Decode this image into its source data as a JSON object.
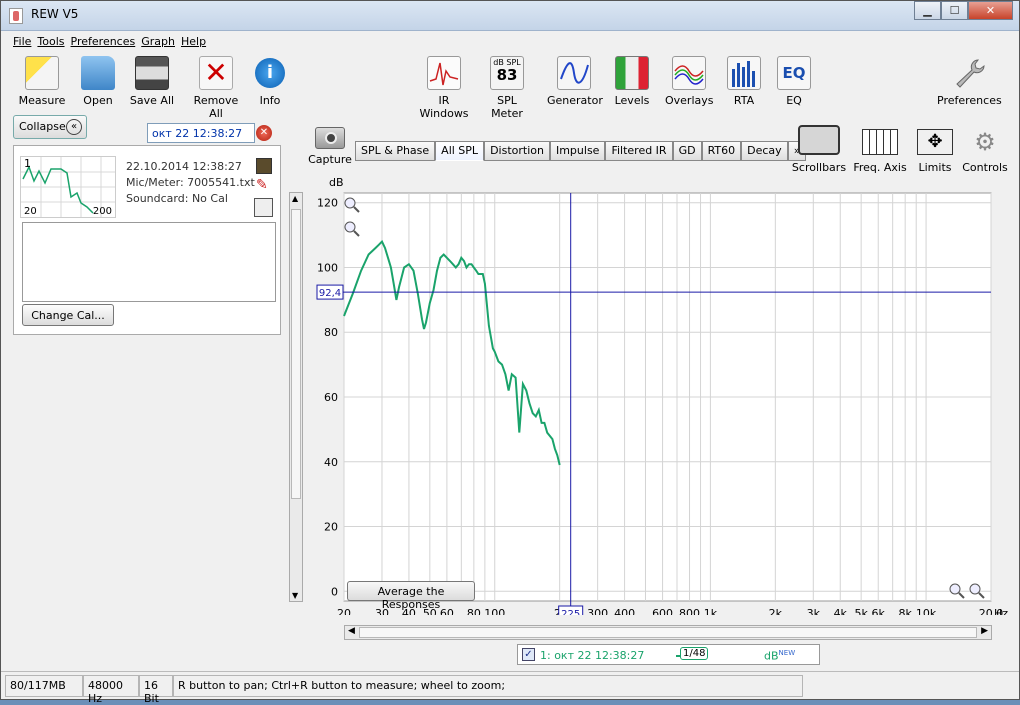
{
  "window": {
    "title": "REW V5"
  },
  "menu": [
    "File",
    "Tools",
    "Preferences",
    "Graph",
    "Help"
  ],
  "toolbar": {
    "left": [
      "Measure",
      "Open",
      "Save All",
      "Remove All",
      "Info"
    ],
    "center": [
      "IR Windows",
      "SPL Meter",
      "Generator",
      "Levels",
      "Overlays",
      "RTA",
      "EQ"
    ],
    "spl_meter_top": "dB SPL",
    "spl_meter_value": "83",
    "right": "Preferences"
  },
  "panel": {
    "collapse_label": "Collapse",
    "measurement_name": "окт 22 12:38:27",
    "thumb_index": "1",
    "thumb_x_start": "20",
    "thumb_x_end": "200",
    "date": "22.10.2014 12:38:27",
    "mic": "Mic/Meter: 7005541.txt",
    "soundcard": "Soundcard: No Cal",
    "change_cal": "Change Cal..."
  },
  "graph_controls": {
    "capture": "Capture",
    "tabs": [
      "SPL & Phase",
      "All SPL",
      "Distortion",
      "Impulse",
      "Filtered IR",
      "GD",
      "RT60",
      "Decay",
      "»"
    ],
    "active_tab": "All SPL",
    "right": [
      "Scrollbars",
      "Freq. Axis",
      "Limits",
      "Controls"
    ],
    "average_button": "Average the Responses"
  },
  "cursor": {
    "y_readout": "92,4",
    "x_readout": "225"
  },
  "legend": {
    "entry": "1: окт 22 12:38:27",
    "smoothing": "1/48",
    "unit": "dB",
    "unit_sup": "NEW",
    "color": "#1aa36b",
    "checked": true
  },
  "status": [
    "80/117MB",
    "48000 Hz",
    "16 Bit",
    "R button to pan; Ctrl+R button to measure; wheel to zoom;"
  ],
  "chart_data": {
    "type": "line",
    "ylabel": "dB",
    "xlabel": "Hz",
    "xscale": "log",
    "xlim": [
      20,
      20000
    ],
    "ylim": [
      -3,
      123
    ],
    "y_ticks": [
      0,
      20,
      40,
      60,
      80,
      100,
      120
    ],
    "x_tick_labels": [
      {
        "v": 20,
        "t": "20"
      },
      {
        "v": 30,
        "t": "30"
      },
      {
        "v": 40,
        "t": "40"
      },
      {
        "v": 50,
        "t": "50"
      },
      {
        "v": 60,
        "t": "60"
      },
      {
        "v": 80,
        "t": "80"
      },
      {
        "v": 100,
        "t": "100"
      },
      {
        "v": 200,
        "t": "2("
      },
      {
        "v": 300,
        "t": "300"
      },
      {
        "v": 400,
        "t": "400"
      },
      {
        "v": 600,
        "t": "600"
      },
      {
        "v": 800,
        "t": "800"
      },
      {
        "v": 1000,
        "t": "1k"
      },
      {
        "v": 2000,
        "t": "2k"
      },
      {
        "v": 3000,
        "t": "3k"
      },
      {
        "v": 4000,
        "t": "4k"
      },
      {
        "v": 5000,
        "t": "5k"
      },
      {
        "v": 6000,
        "t": "6k"
      },
      {
        "v": 8000,
        "t": "8k"
      },
      {
        "v": 10000,
        "t": "10k"
      },
      {
        "v": 20000,
        "t": "20,0"
      }
    ],
    "grid": true,
    "cursor": {
      "x": 225,
      "y": 92.4
    },
    "series": [
      {
        "name": "1: окт 22 12:38:27",
        "color": "#1aa36b",
        "x": [
          20,
          22,
          24,
          26,
          28,
          29,
          30,
          31,
          32,
          33,
          34,
          35,
          36,
          37,
          38,
          40,
          42,
          44,
          46,
          47,
          48,
          49,
          50,
          52,
          54,
          56,
          58,
          60,
          62,
          64,
          66,
          68,
          70,
          72,
          74,
          76,
          78,
          80,
          82,
          84,
          86,
          88,
          90,
          94,
          98,
          100,
          104,
          108,
          112,
          116,
          120,
          125,
          130,
          135,
          140,
          145,
          150,
          155,
          160,
          165,
          170,
          175,
          180,
          185,
          190,
          195,
          200
        ],
        "y": [
          85,
          92,
          99,
          104,
          106,
          107,
          108,
          106,
          103,
          100,
          95,
          90,
          94,
          97,
          100,
          101,
          99,
          92,
          84,
          81,
          83,
          86,
          89,
          93,
          99,
          103,
          104,
          103,
          102,
          101,
          100,
          101,
          103,
          102,
          100,
          101,
          101,
          100,
          99,
          98,
          98,
          98,
          95,
          82,
          75,
          74,
          71,
          70,
          67,
          62,
          67,
          66,
          49,
          64,
          62,
          58,
          55,
          54,
          56,
          52,
          52,
          49,
          48,
          47,
          44,
          42,
          39
        ]
      }
    ]
  }
}
